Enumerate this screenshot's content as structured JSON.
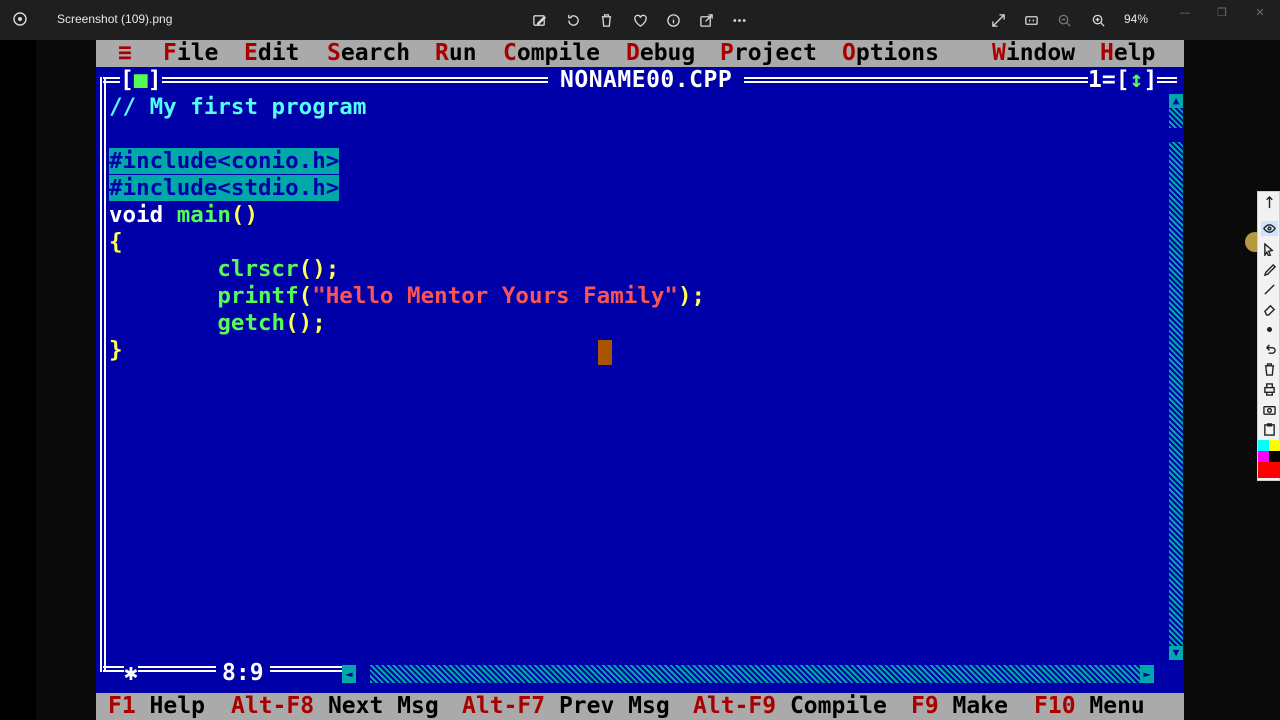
{
  "viewer": {
    "file_name": "Screenshot (109).png",
    "zoom": "94%",
    "minimize": "—",
    "maximize": "❐",
    "close": "✕"
  },
  "ide": {
    "menu": [
      {
        "hot": "≡",
        "rest": ""
      },
      {
        "hot": "F",
        "rest": "ile"
      },
      {
        "hot": "E",
        "rest": "dit"
      },
      {
        "hot": "S",
        "rest": "earch"
      },
      {
        "hot": "R",
        "rest": "un"
      },
      {
        "hot": "C",
        "rest": "ompile"
      },
      {
        "hot": "D",
        "rest": "ebug"
      },
      {
        "hot": "P",
        "rest": "roject"
      },
      {
        "hot": "O",
        "rest": "ptions"
      },
      {
        "hot": "W",
        "rest": "indow"
      },
      {
        "hot": "H",
        "rest": "elp"
      }
    ],
    "window_title": "NONAME00.CPP",
    "close_box_left": "[",
    "close_box_mark": "■",
    "close_box_right": "]",
    "window_number": "1",
    "zoom_box_left": "[",
    "zoom_box_mark": "↕",
    "zoom_box_right": "]",
    "code": {
      "l1": "// My first program",
      "l3": "#include<conio.h>",
      "l4": "#include<stdio.h>",
      "l5_kw": "void",
      "l5_fn": "main",
      "l5_punc": "()",
      "l6": "{",
      "l7_indent": "        ",
      "l7_fn": "clrscr",
      "l7_punc": "();",
      "l8_fn": "printf",
      "l8_open": "(",
      "l8_str": "\"Hello Mentor Yours Family\"",
      "l8_close": ");",
      "l9_fn": "getch",
      "l9_punc": "();",
      "l10": "}"
    },
    "cursor_position": "8:9",
    "corner_mark": "✱",
    "status": [
      {
        "key": "F1",
        "label": " Help"
      },
      {
        "key": "Alt-F8",
        "label": " Next Msg"
      },
      {
        "key": "Alt-F7",
        "label": " Prev Msg"
      },
      {
        "key": "Alt-F9",
        "label": " Compile"
      },
      {
        "key": "F9",
        "label": " Make"
      },
      {
        "key": "F10",
        "label": " Menu"
      }
    ],
    "scroll": {
      "up": "▲",
      "down": "▼",
      "left": "◄",
      "right": "►"
    }
  },
  "colors": {
    "ide_background": "#0000a8",
    "menu_background": "#aaaaaa",
    "hotkey": "#a80000",
    "comment": "#54fcfc",
    "string": "#fc5454",
    "identifier": "#54fc54",
    "punctuation": "#ffff54"
  },
  "annotation_tools": [
    "pen-icon",
    "eye-icon",
    "pointer-icon",
    "highlighter-icon",
    "line-icon",
    "eraser-icon",
    "dot-icon",
    "undo-icon",
    "trash-icon",
    "print-icon",
    "camera-icon",
    "clipboard-icon"
  ]
}
